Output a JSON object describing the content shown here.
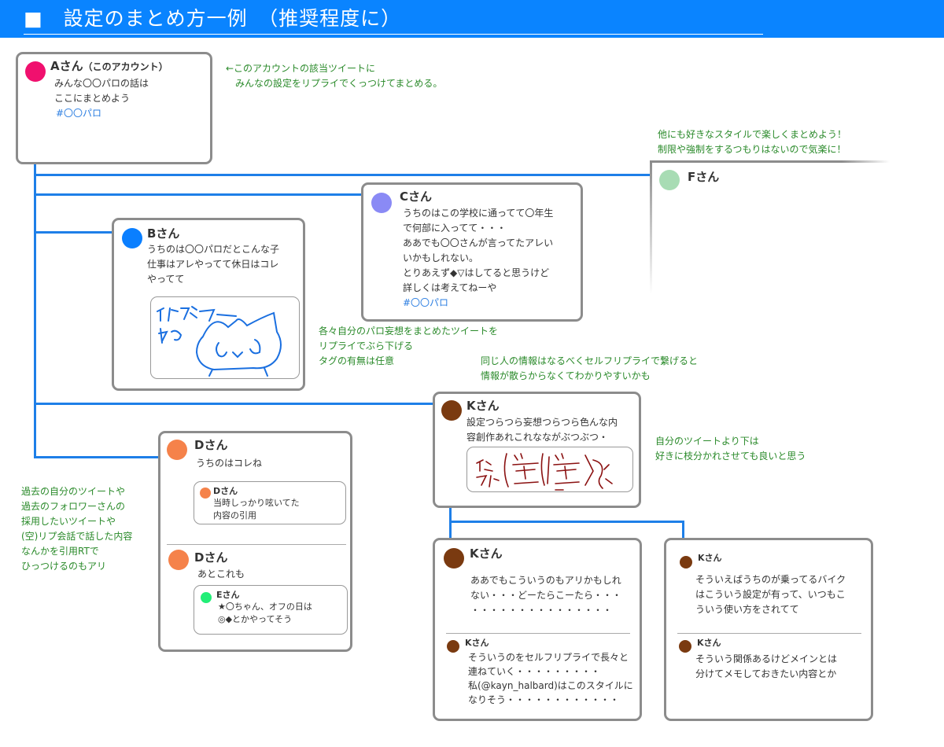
{
  "header": {
    "title": "■　設定のまとめ方一例　（推奨程度に）"
  },
  "colors": {
    "header": "#0a84ff",
    "line": "#1e7fe8",
    "note": "#2a8a2a",
    "tag": "#2a7de1",
    "a": "#f0106e",
    "b": "#0a7fff",
    "c": "#8a8af5",
    "d": "#f5824a",
    "e": "#22ee77",
    "f": "#a8dcb4",
    "k": "#7a3a10"
  },
  "card_a": {
    "name": "Aさん",
    "sub": "（このアカウント）",
    "lines": [
      "みんな〇〇パロの話は",
      "ここにまとめよう"
    ],
    "tag": "#〇〇パロ"
  },
  "card_b": {
    "name": "Bさん",
    "lines": [
      "うちのは〇〇パロだとこんな子",
      "仕事はアレやってて休日はコレ",
      "やってて"
    ],
    "illust_text": "イラストとか"
  },
  "card_c": {
    "name": "Cさん",
    "lines": [
      "うちのはこの学校に通ってて〇年生",
      "で何部に入ってて・・・",
      "ああでも〇〇さんが言ってたアレい",
      "いかもしれない。",
      "とりあえず◆▽はしてると思うけど",
      "詳しくは考えてねーや"
    ],
    "tag": "#〇〇パロ"
  },
  "card_f": {
    "name": "Fさん"
  },
  "card_d": {
    "name": "Dさん",
    "text": "うちのはコレね",
    "quote1": {
      "name": "Dさん",
      "lines": [
        "当時しっかり呟いてた",
        "内容の引用"
      ]
    },
    "name2": "Dさん",
    "text2": "あとこれも",
    "quote2": {
      "name": "Eさん",
      "lines": [
        "★〇ちゃん、オフの日は",
        "◎◆とかやってそう"
      ]
    }
  },
  "card_k1": {
    "name": "Kさん",
    "lines": [
      "設定つらつら妄想つらつら色んな内",
      "容創作あれこれなながぶつぶつ・"
    ],
    "illust_text": "イラスト"
  },
  "card_k2": {
    "name": "Kさん",
    "lines": [
      "ああでもこういうのもアリかもしれ",
      "ない・・・どーたらこーたら・・・",
      "・・・・・・・・・・・・・・・"
    ],
    "name2": "Kさん",
    "lines2": [
      "そういうのをセルフリプライで長々と",
      "連ねていく・・・・・・・・・",
      "私(@kayn_halbard)はこのスタイルに",
      "なりそう・・・・・・・・・・・・"
    ]
  },
  "card_k3": {
    "name": "Kさん",
    "lines": [
      "そういえばうちのが乗ってるバイク",
      "はこういう設定が有って、いつもこ",
      "ういう使い方をされてて"
    ],
    "name2": "Kさん",
    "lines2": [
      "そういう関係あるけどメインとは",
      "分けてメモしておきたい内容とか"
    ]
  },
  "notes": {
    "top": [
      "←このアカウントの該当ツイートに",
      "　みんなの設定をリプライでくっつけてまとめる。"
    ],
    "style": [
      "他にも好きなスタイルで楽しくまとめよう！",
      "制限や強制をするつもりはないので気楽に！"
    ],
    "reply": [
      "各々自分のパロ妄想をまとめたツイートを",
      "リプライでぶら下げる",
      "タグの有無は任意"
    ],
    "self": [
      "同じ人の情報はなるべくセルフリプライで繋げると",
      "情報が散らからなくてわかりやすいかも"
    ],
    "branch": [
      "自分のツイートより下は",
      "好きに枝分かれさせても良いと思う"
    ],
    "quote": [
      "過去の自分のツイートや",
      "過去のフォロワーさんの",
      "採用したいツイートや",
      "(空)リプ会話で話した内容",
      "なんかを引用RTで",
      "ひっつけるのもアリ"
    ]
  }
}
